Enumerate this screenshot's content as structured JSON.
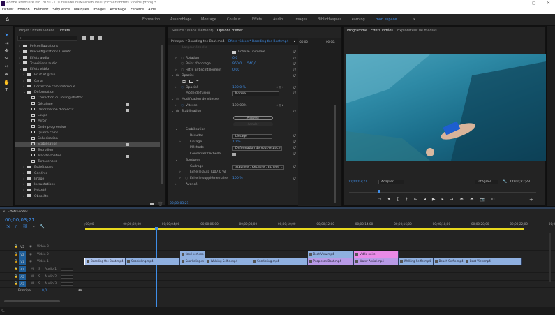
{
  "window": {
    "title": "Adobe Premiere Pro 2020 - C:\\Utilisateurs\\Malko\\Bureau\\Fichiers\\Effets vidéos.prproj *",
    "controls": [
      "–",
      "▢",
      "✕"
    ]
  },
  "menu": [
    "Fichier",
    "Edition",
    "Elément",
    "Séquence",
    "Marques",
    "Images",
    "Affichage",
    "Fenêtre",
    "Aide"
  ],
  "workspaces": [
    "Formation",
    "Assemblage",
    "Montage",
    "Couleur",
    "Effets",
    "Audio",
    "Images",
    "Bibliothèques",
    "Learning",
    "mon espace"
  ],
  "workspace_active": "mon espace",
  "workspace_more": "»",
  "effects_panel": {
    "tabs": [
      "Projet : Effets vidéos",
      "Effets"
    ],
    "active_tab": "Effets",
    "search_placeholder": "",
    "tree": [
      {
        "label": "Préconfigurations",
        "type": "folder",
        "level": 0,
        "expanded": false
      },
      {
        "label": "Préconfigurations Lumetri",
        "type": "folder",
        "level": 0,
        "expanded": false
      },
      {
        "label": "Effets audio",
        "type": "folder",
        "level": 0,
        "expanded": false
      },
      {
        "label": "Transitions audio",
        "type": "folder",
        "level": 0,
        "expanded": false
      },
      {
        "label": "Effets vidéo",
        "type": "folder",
        "level": 0,
        "expanded": true
      },
      {
        "label": "Bruit et grain",
        "type": "folder",
        "level": 1,
        "expanded": false
      },
      {
        "label": "Canal",
        "type": "folder",
        "level": 1,
        "expanded": false
      },
      {
        "label": "Correction colorimétrique",
        "type": "folder",
        "level": 1,
        "expanded": false
      },
      {
        "label": "Déformation",
        "type": "folder",
        "level": 1,
        "expanded": true
      },
      {
        "label": "Correction du rolling shutter",
        "type": "effect",
        "level": 2
      },
      {
        "label": "Décalage",
        "type": "effect",
        "level": 2,
        "accelerated": true
      },
      {
        "label": "Déformation d'objectif",
        "type": "effect",
        "level": 2,
        "accelerated": true
      },
      {
        "label": "Loupe",
        "type": "effect",
        "level": 2
      },
      {
        "label": "Miroir",
        "type": "effect",
        "level": 2
      },
      {
        "label": "Onde progressive",
        "type": "effect",
        "level": 2
      },
      {
        "label": "Quatre coins",
        "type": "effect",
        "level": 2
      },
      {
        "label": "Sphérisation",
        "type": "effect",
        "level": 2
      },
      {
        "label": "Stabilisation",
        "type": "effect",
        "level": 2,
        "accelerated": true,
        "selected": true
      },
      {
        "label": "Tourbillon",
        "type": "effect",
        "level": 2
      },
      {
        "label": "Transformation",
        "type": "effect",
        "level": 2,
        "accelerated": true
      },
      {
        "label": "Turbulences",
        "type": "effect",
        "level": 2
      },
      {
        "label": "Esthétiques",
        "type": "folder",
        "level": 1,
        "expanded": false
      },
      {
        "label": "Générer",
        "type": "folder",
        "level": 1,
        "expanded": false
      },
      {
        "label": "Image",
        "type": "folder",
        "level": 1,
        "expanded": false
      },
      {
        "label": "Incrustations",
        "type": "folder",
        "level": 1,
        "expanded": false
      },
      {
        "label": "Netteté",
        "type": "folder",
        "level": 1,
        "expanded": false
      },
      {
        "label": "Obsolète",
        "type": "folder",
        "level": 1,
        "expanded": false
      }
    ]
  },
  "effect_options": {
    "tabs": [
      "Source : (sans élément)",
      "Options d'effet"
    ],
    "active_tab": "Options d'effet",
    "master": "Principal * Boarding the Boat.mp4",
    "clip": "Effets vidéos * Boarding the Boat.mp4",
    "mini_ruler": [
      ";00;00",
      "00;00;"
    ],
    "rows": {
      "largeur": "Largeur échelle",
      "echelle_uniforme": "Echelle uniforme",
      "rotation": {
        "label": "Rotation",
        "value": "0,0"
      },
      "ancrage": {
        "label": "Point d'ancrage",
        "x": "960,0",
        "y": "540,0"
      },
      "filtre": {
        "label": "Filtre antiscintillement",
        "value": "0,00"
      },
      "opacite_group": "Opacité",
      "opacite": {
        "label": "Opacité",
        "value": "100,0 %"
      },
      "fusion": {
        "label": "Mode de fusion",
        "value": "Normal"
      },
      "vitesse_group": "Modification de vitesse",
      "vitesse": {
        "label": "Vitesse",
        "value": "100,00%"
      },
      "stab_group": "Stabilisation",
      "analyser": "Analyser",
      "annuler": "Annuler",
      "stab_sub": "Stabilisation",
      "resultat": {
        "label": "Résultat",
        "value": "Lissage"
      },
      "lissage": {
        "label": "Lissage",
        "value": "10 %"
      },
      "methode": {
        "label": "Méthode",
        "value": "Déformation de sous-espace"
      },
      "conserver": "Conserver l'échelle",
      "bordures": "Bordures",
      "cadrage": {
        "label": "Cadrage",
        "value": "Stabiliser, Recadrer, Echelle ..."
      },
      "echelle_auto": "Echelle auto (107,0 %)",
      "echelle_supp": {
        "label": "Echelle supplémentaire",
        "value": "100 %"
      },
      "avance": "Avancé"
    },
    "timecode": "00;00;03;21"
  },
  "program": {
    "tabs": [
      "Programme : Effets vidéos",
      "Explorateur de médias"
    ],
    "active_tab": "Programme : Effets vidéos",
    "timecode": "00;00;03;21",
    "fit": "Adapter",
    "quality": "Intégrale",
    "duration": "00;00;22;23",
    "playhead_fraction": 0.161
  },
  "timeline": {
    "title": "Effets vidéos",
    "timecode": "00;00;03;21",
    "ruler": [
      ";00;00",
      "00;00;02;00",
      "00;00;04;00",
      "00;00;06;00",
      "00;00;08;00",
      "00;00;10;00",
      "00;00;12;00",
      "00;00;14;00",
      "00;00;16;00",
      "00;00;18;00",
      "00;00;20;00",
      "00;00;22;00",
      "00;00"
    ],
    "playhead_seconds": 3.7,
    "video_tracks": [
      {
        "id": "V3",
        "name": "Vidéo 3"
      },
      {
        "id": "V2",
        "name": "Vidéo 2"
      },
      {
        "id": "V1",
        "name": "Vidéo 1"
      }
    ],
    "audio_tracks": [
      {
        "id": "A1",
        "name": "Audio 1"
      },
      {
        "id": "A2",
        "name": "Audio 2"
      },
      {
        "id": "A3",
        "name": "Audio 3"
      }
    ],
    "master": {
      "label": "Principal",
      "value": "0,0"
    },
    "clips": {
      "V2": [
        {
          "name": "fond vert.mp",
          "start": 4.9,
          "end": 6.2,
          "color": "#8fb0e0"
        },
        {
          "name": "Boat View.mp4",
          "start": 11.5,
          "end": 13.9,
          "color": "#8fb0e0"
        },
        {
          "name": "Vidéo noire",
          "start": 13.9,
          "end": 16.2,
          "color": "#e98ae6"
        }
      ],
      "V1": [
        {
          "name": "Boarding the Boat.mp4",
          "start": 0,
          "end": 2.1,
          "color": "#a8c0ea",
          "selected": true
        },
        {
          "name": "Snorkeling.mp4",
          "start": 2.1,
          "end": 4.9,
          "color": "#8fb0e0"
        },
        {
          "name": "Snorkeling.m",
          "start": 4.9,
          "end": 6.2,
          "color": "#8fb0e0"
        },
        {
          "name": "Walking Selfie.mp4",
          "start": 6.2,
          "end": 8.6,
          "color": "#8fb0e0"
        },
        {
          "name": "Snorkeling.mp4",
          "start": 8.6,
          "end": 11.5,
          "color": "#8fb0e0"
        },
        {
          "name": "People on Boat.mp4",
          "start": 11.5,
          "end": 13.9,
          "color": "#b89ae6"
        },
        {
          "name": "Water Aerial.mp4",
          "start": 13.9,
          "end": 16.2,
          "color": "#b89ae6"
        },
        {
          "name": "Walking Selfie.mp4",
          "start": 16.2,
          "end": 18.0,
          "color": "#8fb0e0"
        },
        {
          "name": "Beach Selfie.mp4",
          "start": 18.0,
          "end": 19.6,
          "color": "#8fb0e0"
        },
        {
          "name": "Boat View.mp4",
          "start": 19.6,
          "end": 22.6,
          "color": "#8fb0e0"
        }
      ]
    }
  },
  "colors": {
    "accent": "#3f8ee8",
    "panel": "#232323",
    "timeline_work_area": "#e8d81e"
  }
}
